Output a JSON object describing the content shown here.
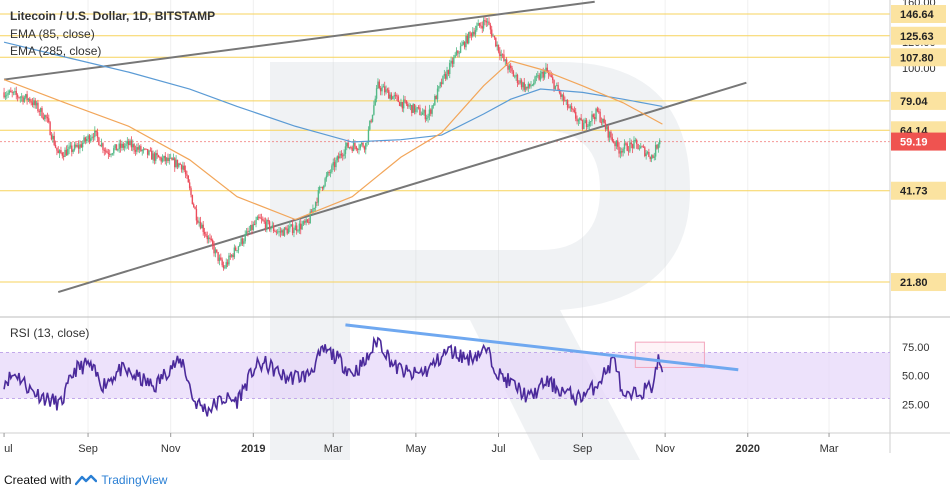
{
  "chart_data": [
    {
      "type": "candlestick",
      "title": "Litecoin / U.S. Dollar, 1D, BITSTAMP",
      "indicators": [
        "EMA (85, close)",
        "EMA (285, close)"
      ],
      "y_scale": "log",
      "ylim": [
        17,
        162
      ],
      "y_ticks": [
        160.0,
        120.0,
        100.0
      ],
      "price_levels": [
        {
          "label": "146.64",
          "value": 146.64
        },
        {
          "label": "125.63",
          "value": 125.63
        },
        {
          "label": "107.80",
          "value": 107.8
        },
        {
          "label": "79.04",
          "value": 79.04
        },
        {
          "label": "64.14",
          "value": 64.14
        },
        {
          "label": "41.73",
          "value": 41.73
        },
        {
          "label": "21.80",
          "value": 21.8
        }
      ],
      "last_price": {
        "label": "59.19",
        "value": 59.19
      },
      "price_path": [
        [
          "2018-07-01",
          84
        ],
        [
          "2018-07-20",
          80
        ],
        [
          "2018-08-01",
          70
        ],
        [
          "2018-08-10",
          54
        ],
        [
          "2018-08-25",
          57
        ],
        [
          "2018-09-05",
          63
        ],
        [
          "2018-09-15",
          55
        ],
        [
          "2018-10-01",
          58
        ],
        [
          "2018-10-20",
          53
        ],
        [
          "2018-11-10",
          50
        ],
        [
          "2018-11-20",
          35
        ],
        [
          "2018-12-10",
          24
        ],
        [
          "2018-12-20",
          28
        ],
        [
          "2019-01-05",
          34
        ],
        [
          "2019-01-20",
          31
        ],
        [
          "2019-02-10",
          33
        ],
        [
          "2019-02-20",
          43
        ],
        [
          "2019-03-10",
          57
        ],
        [
          "2019-03-25",
          58
        ],
        [
          "2019-04-03",
          88
        ],
        [
          "2019-04-20",
          78
        ],
        [
          "2019-05-10",
          71
        ],
        [
          "2019-05-20",
          90
        ],
        [
          "2019-06-01",
          112
        ],
        [
          "2019-06-12",
          130
        ],
        [
          "2019-06-22",
          140
        ],
        [
          "2019-07-05",
          105
        ],
        [
          "2019-07-12",
          95
        ],
        [
          "2019-07-22",
          86
        ],
        [
          "2019-08-05",
          98
        ],
        [
          "2019-08-20",
          77
        ],
        [
          "2019-09-01",
          66
        ],
        [
          "2019-09-12",
          73
        ],
        [
          "2019-09-20",
          63
        ],
        [
          "2019-09-28",
          56
        ],
        [
          "2019-10-10",
          58
        ],
        [
          "2019-10-23",
          53
        ],
        [
          "2019-10-28",
          61
        ]
      ],
      "ema_85": [
        [
          "2018-07-01",
          92
        ],
        [
          "2018-08-15",
          78
        ],
        [
          "2018-10-01",
          66
        ],
        [
          "2018-11-15",
          52
        ],
        [
          "2018-12-20",
          40
        ],
        [
          "2019-02-01",
          34
        ],
        [
          "2019-03-15",
          40
        ],
        [
          "2019-04-20",
          53
        ],
        [
          "2019-05-20",
          63
        ],
        [
          "2019-06-20",
          88
        ],
        [
          "2019-07-10",
          105
        ],
        [
          "2019-08-01",
          99
        ],
        [
          "2019-09-01",
          88
        ],
        [
          "2019-10-01",
          78
        ],
        [
          "2019-10-30",
          67
        ]
      ],
      "ema_285": [
        [
          "2018-07-01",
          120
        ],
        [
          "2018-08-15",
          108
        ],
        [
          "2018-10-01",
          97
        ],
        [
          "2018-11-15",
          86
        ],
        [
          "2018-12-20",
          76
        ],
        [
          "2019-02-01",
          66
        ],
        [
          "2019-03-15",
          59
        ],
        [
          "2019-04-20",
          60
        ],
        [
          "2019-05-20",
          62
        ],
        [
          "2019-06-20",
          72
        ],
        [
          "2019-07-10",
          80
        ],
        [
          "2019-08-01",
          86
        ],
        [
          "2019-09-01",
          84
        ],
        [
          "2019-10-01",
          80
        ],
        [
          "2019-10-30",
          76
        ]
      ],
      "trendlines": [
        {
          "from": [
            "2018-07-01",
            92
          ],
          "to": [
            "2019-09-10",
            160
          ]
        },
        {
          "from": [
            "2018-08-10",
            20.3
          ],
          "to": [
            "2019-12-31",
            90
          ]
        }
      ]
    },
    {
      "type": "line",
      "title": "RSI (13, close)",
      "ylim": [
        0,
        100
      ],
      "y_ticks": [
        75.0,
        50.0,
        25.0
      ],
      "band": [
        30,
        70
      ],
      "x_ticks": [
        "ul",
        "Sep",
        "Nov",
        "2019",
        "Mar",
        "May",
        "Jul",
        "Sep",
        "Nov",
        "2020",
        "Mar"
      ],
      "values": [
        [
          "2018-07-01",
          45
        ],
        [
          "2018-07-10",
          52
        ],
        [
          "2018-07-20",
          38
        ],
        [
          "2018-08-01",
          30
        ],
        [
          "2018-08-12",
          25
        ],
        [
          "2018-08-22",
          55
        ],
        [
          "2018-09-01",
          60
        ],
        [
          "2018-09-12",
          42
        ],
        [
          "2018-09-25",
          55
        ],
        [
          "2018-10-08",
          48
        ],
        [
          "2018-10-20",
          40
        ],
        [
          "2018-11-01",
          58
        ],
        [
          "2018-11-10",
          62
        ],
        [
          "2018-11-18",
          28
        ],
        [
          "2018-11-28",
          20
        ],
        [
          "2018-12-10",
          30
        ],
        [
          "2018-12-20",
          28
        ],
        [
          "2019-01-02",
          57
        ],
        [
          "2019-01-10",
          60
        ],
        [
          "2019-01-25",
          48
        ],
        [
          "2019-02-10",
          50
        ],
        [
          "2019-02-22",
          72
        ],
        [
          "2019-03-01",
          68
        ],
        [
          "2019-03-15",
          52
        ],
        [
          "2019-03-25",
          62
        ],
        [
          "2019-04-03",
          82
        ],
        [
          "2019-04-15",
          58
        ],
        [
          "2019-04-28",
          50
        ],
        [
          "2019-05-10",
          55
        ],
        [
          "2019-05-25",
          72
        ],
        [
          "2019-06-08",
          65
        ],
        [
          "2019-06-22",
          72
        ],
        [
          "2019-07-02",
          50
        ],
        [
          "2019-07-12",
          42
        ],
        [
          "2019-07-24",
          30
        ],
        [
          "2019-08-05",
          45
        ],
        [
          "2019-08-15",
          38
        ],
        [
          "2019-08-28",
          30
        ],
        [
          "2019-09-08",
          38
        ],
        [
          "2019-09-20",
          56
        ],
        [
          "2019-09-25",
          66
        ],
        [
          "2019-10-01",
          28
        ],
        [
          "2019-10-12",
          35
        ],
        [
          "2019-10-22",
          40
        ],
        [
          "2019-10-27",
          63
        ],
        [
          "2019-10-30",
          56
        ]
      ],
      "trendline": {
        "from": [
          "2019-03-10",
          94
        ],
        "to": [
          "2019-12-25",
          55
        ]
      }
    }
  ],
  "footer": {
    "prefix": "Created with",
    "brand": "TradingView"
  },
  "colors": {
    "up": "#53b987",
    "down": "#eb4d5c",
    "ema85": "#f2a65a",
    "ema285": "#5b9bd5",
    "level": "#f7d35c",
    "trend": "#777777",
    "rsi": "#4b2a9b",
    "rsi_band": "#e6d6fa",
    "rsi_trend": "#6fa8f0",
    "last_price": "#ef5350"
  }
}
